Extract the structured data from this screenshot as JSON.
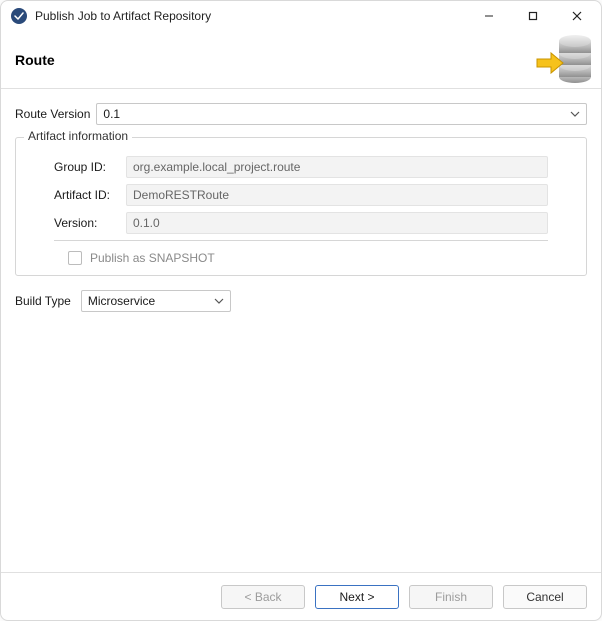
{
  "window": {
    "title": "Publish Job to Artifact Repository"
  },
  "header": {
    "title": "Route"
  },
  "route_version": {
    "label": "Route Version",
    "value": "0.1"
  },
  "artifact_info": {
    "legend": "Artifact information",
    "group_id_label": "Group ID:",
    "group_id_value": "org.example.local_project.route",
    "artifact_id_label": "Artifact ID:",
    "artifact_id_value": "DemoRESTRoute",
    "version_label": "Version:",
    "version_value": "0.1.0",
    "snapshot_label": "Publish as SNAPSHOT",
    "snapshot_checked": false
  },
  "build_type": {
    "label": "Build Type",
    "value": "Microservice"
  },
  "buttons": {
    "back": "< Back",
    "next": "Next >",
    "finish": "Finish",
    "cancel": "Cancel"
  }
}
